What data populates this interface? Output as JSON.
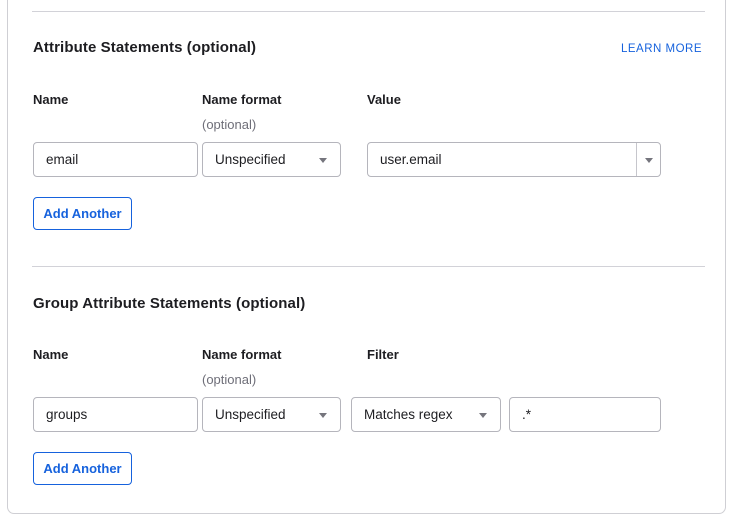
{
  "colors": {
    "accent_blue": "#1662dd",
    "text": "#1d1d21",
    "muted_text": "#6e6e78",
    "input_border": "#b5b5bc",
    "card_border": "#cfcfd4",
    "divider": "#d2d2d8"
  },
  "icons": {
    "dropdown_caret": "▾"
  },
  "attribute_statements": {
    "title": "Attribute Statements (optional)",
    "learn_more_label": "LEARN MORE",
    "columns": {
      "name": "Name",
      "name_format": "Name format",
      "name_format_hint": "(optional)",
      "value": "Value"
    },
    "rows": [
      {
        "name": "email",
        "name_format": "Unspecified",
        "value": "user.email"
      }
    ],
    "add_another_label": "Add Another"
  },
  "group_attribute_statements": {
    "title": "Group Attribute Statements (optional)",
    "columns": {
      "name": "Name",
      "name_format": "Name format",
      "name_format_hint": "(optional)",
      "filter": "Filter"
    },
    "rows": [
      {
        "name": "groups",
        "name_format": "Unspecified",
        "filter_type": "Matches regex",
        "filter_value": ".*"
      }
    ],
    "add_another_label": "Add Another"
  }
}
